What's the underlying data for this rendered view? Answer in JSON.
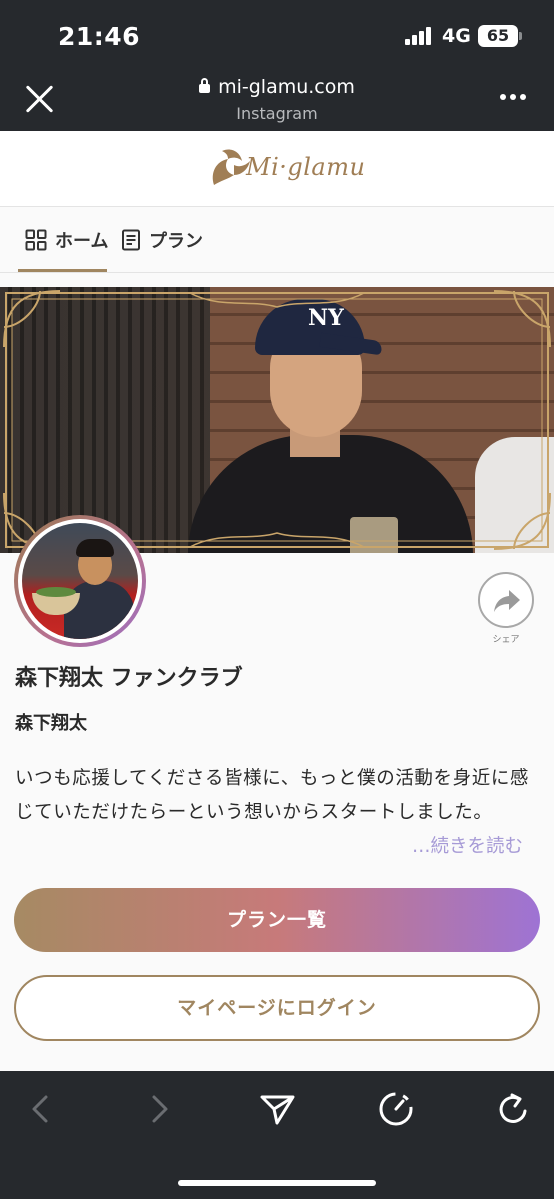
{
  "status_bar": {
    "time": "21:46",
    "network": "4G",
    "battery": "65"
  },
  "browser": {
    "url": "mi-glamu.com",
    "source": "Instagram"
  },
  "header": {
    "logo_text": "Mi·glamu"
  },
  "tabs": [
    {
      "label": "ホーム",
      "icon": "grid-icon",
      "active": true
    },
    {
      "label": "プラン",
      "icon": "document-icon",
      "active": false
    }
  ],
  "profile": {
    "fanclub_name": "森下翔太 ファンクラブ",
    "owner_name": "森下翔太",
    "description": "いつも応援してくださる皆様に、もっと僕の活動を身近に感じていただけたらーという想いからスタートしました。",
    "read_more": "…続きを読む",
    "share_label": "シェア"
  },
  "actions": {
    "plans_button": "プラン一覧",
    "login_button": "マイページにログイン"
  },
  "colors": {
    "brand_gold": "#a08660",
    "gradient_start": "#a68a63",
    "gradient_end": "#9e73d4",
    "chrome_dark": "#26292d"
  }
}
